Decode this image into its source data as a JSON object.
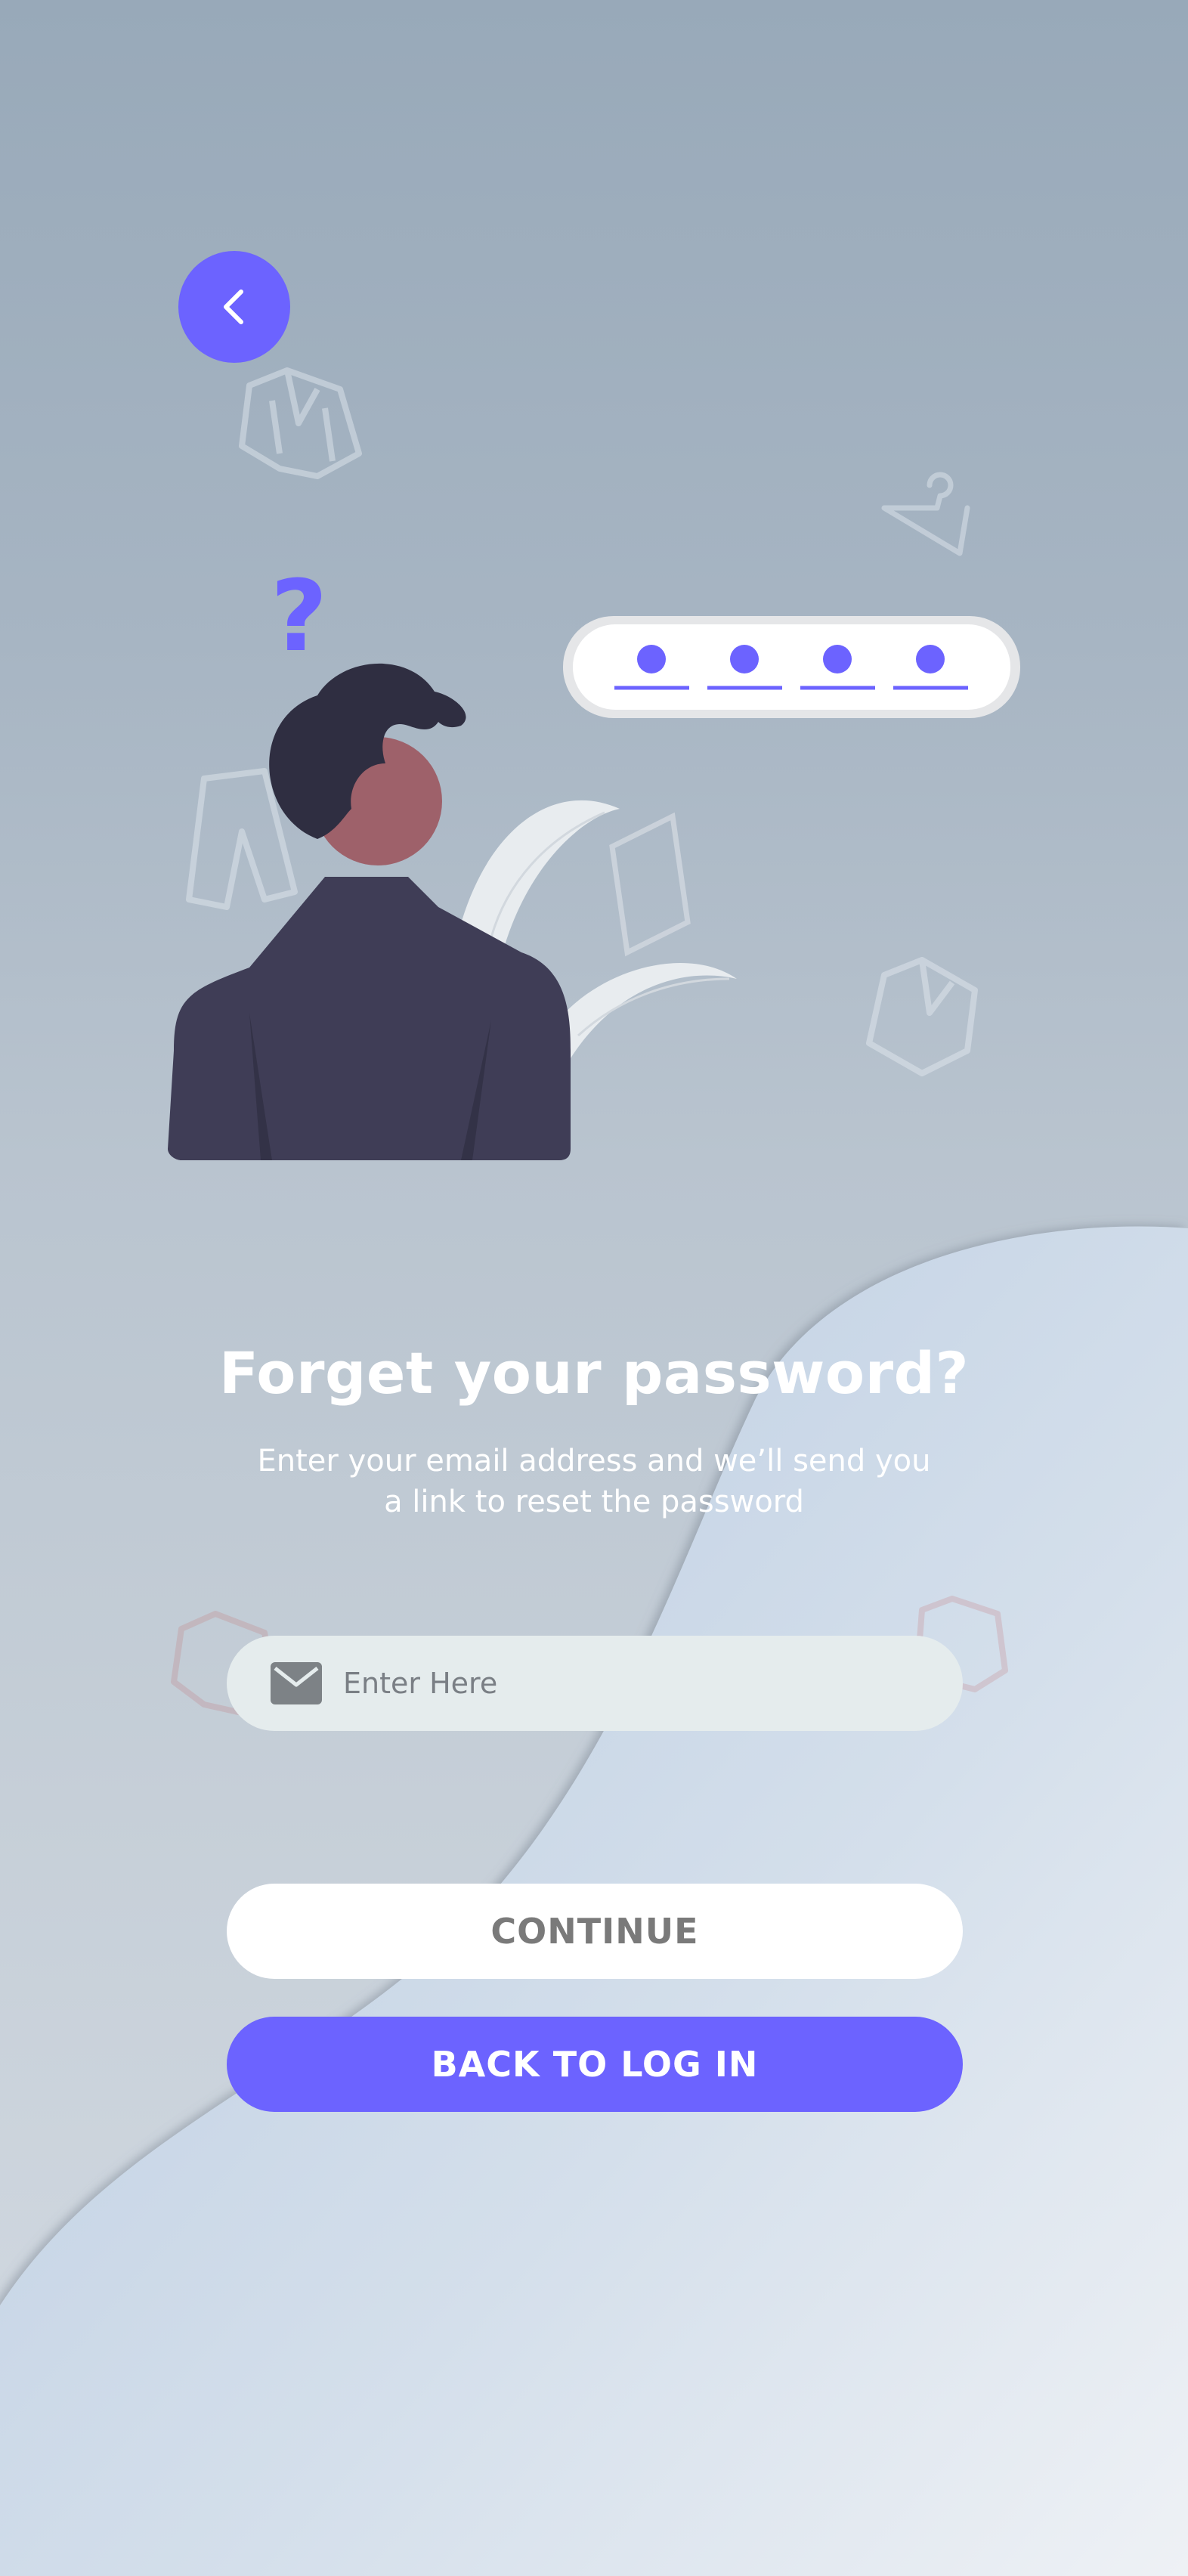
{
  "header": {
    "back_icon": "chevron-left-icon"
  },
  "illustration": {
    "pin_dots": 4,
    "question_mark": "?"
  },
  "main": {
    "title": "Forget your password?",
    "subtitle_line1": "Enter your email address and we’ll send you",
    "subtitle_line2": "a link to reset the password"
  },
  "form": {
    "email_icon": "mail-icon",
    "email_placeholder": "Enter Here",
    "email_value": ""
  },
  "actions": {
    "continue_label": "CONTINUE",
    "back_to_login_label": "BACK TO LOG IN"
  },
  "colors": {
    "accent": "#6c63ff",
    "field_bg": "#e5eced",
    "button_light": "#ffffff",
    "text_white": "#ffffff"
  }
}
